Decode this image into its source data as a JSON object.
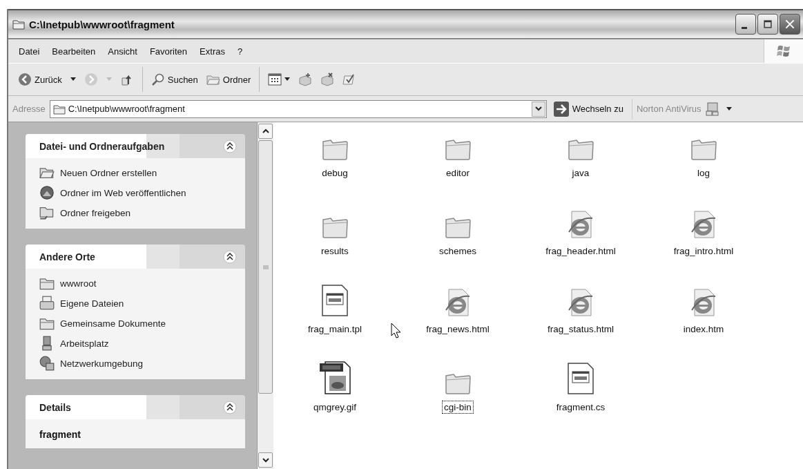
{
  "window": {
    "title": "C:\\Inetpub\\wwwroot\\fragment"
  },
  "menu": [
    "Datei",
    "Bearbeiten",
    "Ansicht",
    "Favoriten",
    "Extras",
    "?"
  ],
  "toolbar": {
    "back": "Zurück",
    "search": "Suchen",
    "folders": "Ordner"
  },
  "address": {
    "label": "Adresse",
    "value": "C:\\Inetpub\\wwwroot\\fragment",
    "go": "Wechseln zu",
    "norton": "Norton AntiVirus"
  },
  "sidebar": [
    {
      "title": "Datei- und Ordneraufgaben",
      "expanded": true,
      "items": [
        {
          "label": "Neuen Ordner erstellen",
          "kind": "new-folder"
        },
        {
          "label": "Ordner im Web veröffentlichen",
          "kind": "globe"
        },
        {
          "label": "Ordner freigeben",
          "kind": "share"
        }
      ]
    },
    {
      "title": "Andere Orte",
      "expanded": true,
      "items": [
        {
          "label": "wwwroot",
          "kind": "folder"
        },
        {
          "label": "Eigene Dateien",
          "kind": "documents"
        },
        {
          "label": "Gemeinsame Dokumente",
          "kind": "folder"
        },
        {
          "label": "Arbeitsplatz",
          "kind": "computer"
        },
        {
          "label": "Netzwerkumgebung",
          "kind": "network"
        }
      ]
    },
    {
      "title": "Details",
      "expanded": true,
      "items": [
        {
          "label": "fragment",
          "kind": "name"
        }
      ]
    }
  ],
  "files": [
    {
      "name": "debug",
      "kind": "folder",
      "focused": false
    },
    {
      "name": "editor",
      "kind": "folder",
      "focused": false
    },
    {
      "name": "java",
      "kind": "folder",
      "focused": false
    },
    {
      "name": "log",
      "kind": "folder",
      "focused": false
    },
    {
      "name": "results",
      "kind": "folder",
      "focused": false
    },
    {
      "name": "schemes",
      "kind": "folder",
      "focused": false
    },
    {
      "name": "frag_header.html",
      "kind": "html",
      "focused": false
    },
    {
      "name": "frag_intro.html",
      "kind": "html",
      "focused": false
    },
    {
      "name": "frag_main.tpl",
      "kind": "template",
      "focused": false
    },
    {
      "name": "frag_news.html",
      "kind": "html",
      "focused": false
    },
    {
      "name": "frag_status.html",
      "kind": "html",
      "focused": false
    },
    {
      "name": "index.htm",
      "kind": "html",
      "focused": false
    },
    {
      "name": "qmgrey.gif",
      "kind": "gif",
      "focused": false
    },
    {
      "name": "cgi-bin",
      "kind": "folder",
      "focused": true
    },
    {
      "name": "fragment.cs",
      "kind": "template",
      "focused": false
    }
  ]
}
